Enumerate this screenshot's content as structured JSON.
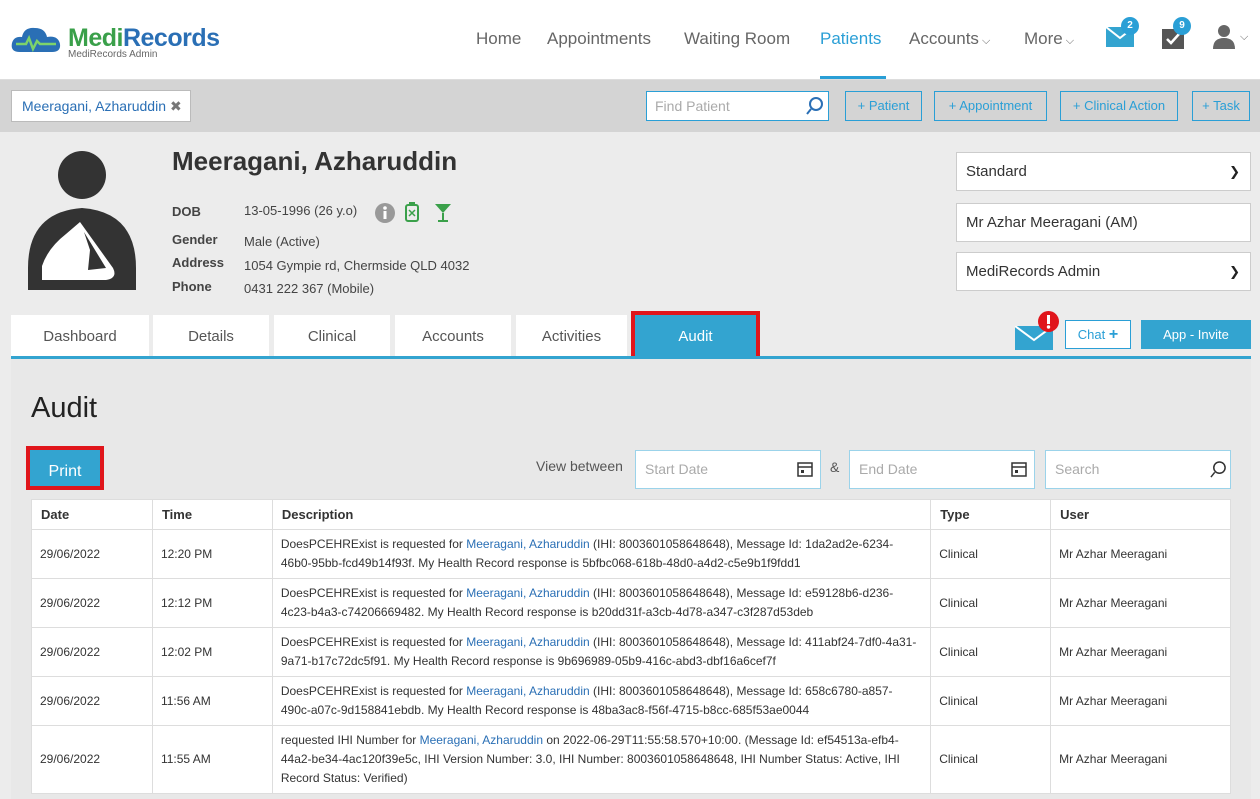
{
  "app": {
    "brand_a": "Medi",
    "brand_b": "Records",
    "brand_sub": "MediRecords Admin"
  },
  "nav": {
    "home": "Home",
    "appointments": "Appointments",
    "waiting_room": "Waiting Room",
    "patients": "Patients",
    "accounts": "Accounts",
    "more": "More",
    "mail_count": "2",
    "tasks_count": "9"
  },
  "context": {
    "patient_chip": "Meeragani, Azharuddin",
    "find_placeholder": "Find Patient",
    "btn_patient": "+ Patient",
    "btn_appointment": "+ Appointment",
    "btn_clinical_action": "+ Clinical Action",
    "btn_task": "+ Task"
  },
  "patient": {
    "name": "Meeragani, Azharuddin",
    "dob_label": "DOB",
    "dob": "13-05-1996 (26 y.o)",
    "gender_label": "Gender",
    "gender": "Male (Active)",
    "address_label": "Address",
    "address": "1054 Gympie rd, Chermside QLD 4032",
    "phone_label": "Phone",
    "phone": "0431 222 367 (Mobile)"
  },
  "side": {
    "template": "Standard",
    "provider": "Mr Azhar Meeragani (AM)",
    "practice": "MediRecords Admin"
  },
  "tabs": {
    "dashboard": "Dashboard",
    "details": "Details",
    "clinical": "Clinical",
    "accounts": "Accounts",
    "activities": "Activities",
    "audit": "Audit"
  },
  "actions": {
    "chat": "Chat",
    "invite": "App - Invite"
  },
  "audit": {
    "title": "Audit",
    "print": "Print",
    "view_between": "View between",
    "start_date": "Start Date",
    "amp": "&",
    "end_date": "End Date",
    "search": "Search",
    "columns": [
      "Date",
      "Time",
      "Description",
      "Type",
      "User"
    ],
    "rows": [
      {
        "date": "29/06/2022",
        "time": "12:20 PM",
        "desc_pre": "DoesPCEHRExist is requested for ",
        "desc_link": "Meeragani, Azharuddin",
        "desc_post": " (IHI: 8003601058648648), Message Id: 1da2ad2e-6234-46b0-95bb-fcd49b14f93f. My Health Record response is 5bfbc068-618b-48d0-a4d2-c5e9b1f9fdd1",
        "type": "Clinical",
        "user": "Mr Azhar Meeragani"
      },
      {
        "date": "29/06/2022",
        "time": "12:12 PM",
        "desc_pre": "DoesPCEHRExist is requested for ",
        "desc_link": "Meeragani, Azharuddin",
        "desc_post": " (IHI: 8003601058648648), Message Id: e59128b6-d236-4c23-b4a3-c74206669482. My Health Record response is b20dd31f-a3cb-4d78-a347-c3f287d53deb",
        "type": "Clinical",
        "user": "Mr Azhar Meeragani"
      },
      {
        "date": "29/06/2022",
        "time": "12:02 PM",
        "desc_pre": "DoesPCEHRExist is requested for ",
        "desc_link": "Meeragani, Azharuddin",
        "desc_post": " (IHI: 8003601058648648), Message Id: 411abf24-7df0-4a31-9a71-b17c72dc5f91. My Health Record response is 9b696989-05b9-416c-abd3-dbf16a6cef7f",
        "type": "Clinical",
        "user": "Mr Azhar Meeragani"
      },
      {
        "date": "29/06/2022",
        "time": "11:56 AM",
        "desc_pre": "DoesPCEHRExist is requested for ",
        "desc_link": "Meeragani, Azharuddin",
        "desc_post": " (IHI: 8003601058648648), Message Id: 658c6780-a857-490c-a07c-9d158841ebdb. My Health Record response is 48ba3ac8-f56f-4715-b8cc-685f53ae0044",
        "type": "Clinical",
        "user": "Mr Azhar Meeragani"
      },
      {
        "date": "29/06/2022",
        "time": "11:55 AM",
        "desc_pre": "requested IHI Number for ",
        "desc_link": "Meeragani, Azharuddin",
        "desc_post": " on 2022-06-29T11:55:58.570+10:00. (Message Id: ef54513a-efb4-44a2-be34-4ac120f39e5c, IHI Version Number: 3.0, IHI Number: 8003601058648648, IHI Number Status: Active, IHI Record Status: Verified)",
        "type": "Clinical",
        "user": "Mr Azhar Meeragani"
      }
    ]
  }
}
